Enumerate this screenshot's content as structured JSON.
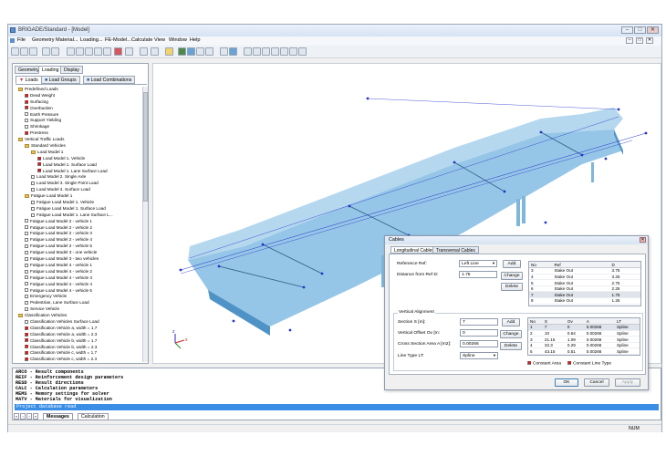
{
  "window": {
    "title": "BRIGADE/Standard - [Model]",
    "controls": [
      "–",
      "□",
      "✕"
    ],
    "child_controls": [
      "–",
      "□",
      "✕"
    ]
  },
  "menu": [
    "File",
    "Geometry",
    "Material...",
    "Loading...",
    "FE-Model...",
    "Calculate",
    "View",
    "Window",
    "Help"
  ],
  "left_panel": {
    "top_tabs": [
      "Geometry",
      "Loading",
      "Display"
    ],
    "sub_tabs": [
      "Loads",
      "Load Groups",
      "Load Combinations"
    ],
    "tree": [
      {
        "level": 0,
        "type": "folder",
        "label": "Predefined Loads"
      },
      {
        "level": 1,
        "type": "check",
        "checked": true,
        "label": "Dead Weight"
      },
      {
        "level": 1,
        "type": "check",
        "checked": true,
        "label": "Surfacing"
      },
      {
        "level": 1,
        "type": "check",
        "checked": true,
        "label": "Overburden"
      },
      {
        "level": 1,
        "type": "check",
        "checked": false,
        "label": "Earth Pressure"
      },
      {
        "level": 1,
        "type": "check",
        "checked": false,
        "label": "Support Yielding"
      },
      {
        "level": 1,
        "type": "check",
        "checked": false,
        "label": "Shrinkage"
      },
      {
        "level": 1,
        "type": "check",
        "checked": true,
        "label": "Prestress"
      },
      {
        "level": 0,
        "type": "folder",
        "label": "Vertical Traffic Loads"
      },
      {
        "level": 1,
        "type": "folder",
        "label": "Standard Vehicles"
      },
      {
        "level": 2,
        "type": "folder",
        "label": "Load Model 1"
      },
      {
        "level": 3,
        "type": "check",
        "checked": true,
        "label": "Load Model 1. Vehicle"
      },
      {
        "level": 3,
        "type": "check",
        "checked": true,
        "label": "Load Model 1. Surface Load"
      },
      {
        "level": 3,
        "type": "check",
        "checked": true,
        "label": "Load Model 1. Lane Surface Load"
      },
      {
        "level": 2,
        "type": "check",
        "checked": false,
        "label": "Load Model 2. Single Axle"
      },
      {
        "level": 2,
        "type": "check",
        "checked": false,
        "label": "Load Model 3. Single Point Load"
      },
      {
        "level": 2,
        "type": "check",
        "checked": false,
        "label": "Load Model 4. Surface Load"
      },
      {
        "level": 1,
        "type": "folder",
        "label": "Fatigue Load Model 1"
      },
      {
        "level": 2,
        "type": "check",
        "checked": false,
        "label": "Fatigue Load Model 1. Vehicle"
      },
      {
        "level": 2,
        "type": "check",
        "checked": false,
        "label": "Fatigue Load Model 1. Surface Load"
      },
      {
        "level": 2,
        "type": "check",
        "checked": false,
        "label": "Fatigue Load Model 1. Lane Surface L..."
      },
      {
        "level": 1,
        "type": "check",
        "checked": false,
        "label": "Fatigue Load Model 2 - vehicle 1"
      },
      {
        "level": 1,
        "type": "check",
        "checked": false,
        "label": "Fatigue Load Model 2 - vehicle 2"
      },
      {
        "level": 1,
        "type": "check",
        "checked": false,
        "label": "Fatigue Load Model 2 - vehicle 3"
      },
      {
        "level": 1,
        "type": "check",
        "checked": false,
        "label": "Fatigue Load Model 2 - vehicle 4"
      },
      {
        "level": 1,
        "type": "check",
        "checked": false,
        "label": "Fatigue Load Model 2 - vehicle 5"
      },
      {
        "level": 1,
        "type": "check",
        "checked": false,
        "label": "Fatigue Load Model 3 - one vehicle"
      },
      {
        "level": 1,
        "type": "check",
        "checked": false,
        "label": "Fatigue Load Model 3 - two vehicles"
      },
      {
        "level": 1,
        "type": "check",
        "checked": false,
        "label": "Fatigue Load Model 4 - vehicle 1"
      },
      {
        "level": 1,
        "type": "check",
        "checked": false,
        "label": "Fatigue Load Model 4 - vehicle 2"
      },
      {
        "level": 1,
        "type": "check",
        "checked": false,
        "label": "Fatigue Load Model 4 - vehicle 3"
      },
      {
        "level": 1,
        "type": "check",
        "checked": false,
        "label": "Fatigue Load Model 4 - vehicle 4"
      },
      {
        "level": 1,
        "type": "check",
        "checked": false,
        "label": "Fatigue Load Model 4 - vehicle 5"
      },
      {
        "level": 1,
        "type": "check",
        "checked": false,
        "label": "Emergency Vehicle"
      },
      {
        "level": 1,
        "type": "check",
        "checked": false,
        "label": "Pedestrian, Lane Surface Load"
      },
      {
        "level": 1,
        "type": "check",
        "checked": false,
        "label": "Service Vehicle"
      },
      {
        "level": 0,
        "type": "folder",
        "label": "Classification Vehicles"
      },
      {
        "level": 1,
        "type": "check",
        "checked": false,
        "label": "Classification Vehicles Surface Load"
      },
      {
        "level": 1,
        "type": "check",
        "checked": true,
        "label": "Classification Vehicle a, width = 1.7"
      },
      {
        "level": 1,
        "type": "check",
        "checked": true,
        "label": "Classification Vehicle a, width = 2.3"
      },
      {
        "level": 1,
        "type": "check",
        "checked": true,
        "label": "Classification Vehicle b, width = 1.7"
      },
      {
        "level": 1,
        "type": "check",
        "checked": true,
        "label": "Classification Vehicle b, width = 2.3"
      },
      {
        "level": 1,
        "type": "check",
        "checked": true,
        "label": "Classification Vehicle c, width = 1.7"
      },
      {
        "level": 1,
        "type": "check",
        "checked": true,
        "label": "Classification Vehicle c, width = 2.3"
      }
    ]
  },
  "messages": {
    "lines": [
      "ARCO    - Result components",
      "REIF    - Reinforcement design parameters",
      "RESD    - Result directions",
      "CALC    - Calculation parameters",
      "MEMS    - Memory settings for solver",
      "MATV    - Materials for visualization"
    ],
    "highlighted": "Project database read",
    "tabs": [
      "Messages",
      "Calculation"
    ]
  },
  "status": {
    "num": "NUM"
  },
  "dialog": {
    "title": "Cables",
    "tabs": [
      "Longitudinal Cables",
      "Transversal Cables"
    ],
    "ref_label": "Reference Ref:",
    "ref_value": "Left Line",
    "add1": "Add",
    "dist_label": "Distance from Ref D:",
    "dist_value": "1.75",
    "change1": "Change",
    "delete1": "Delete",
    "table1": {
      "headers": [
        "No",
        "Ref",
        "D"
      ],
      "rows": [
        [
          "3",
          "Stake Out",
          "3.75"
        ],
        [
          "4",
          "Stake Out",
          "3.25"
        ],
        [
          "5",
          "Stake Out",
          "2.75"
        ],
        [
          "6",
          "Stake Out",
          "2.25"
        ],
        [
          "7",
          "Stake Out",
          "1.75"
        ],
        [
          "8",
          "Stake Out",
          "1.25"
        ]
      ]
    },
    "va_title": "Vertical Alignment",
    "section_label": "Section S [m]:",
    "section_value": "7",
    "add2": "Add",
    "voffset_label": "Vertical Offset Ov [m:",
    "voffset_value": "0",
    "change2": "Change",
    "area_label": "Cross Section Area  A [m2]:",
    "area_value": "0.00266",
    "delete2": "Delete",
    "linetype_label": "Line Type LT:",
    "linetype_value": "Spline",
    "table2": {
      "headers": [
        "No",
        "S",
        "Ov",
        "A",
        "LT"
      ],
      "rows": [
        [
          "1",
          "7",
          "0",
          "0.00266",
          "Spline"
        ],
        [
          "2",
          "10",
          "0.64",
          "0.00266",
          "Spline"
        ],
        [
          "3",
          "21.15",
          "1.09",
          "0.00266",
          "Spline"
        ],
        [
          "4",
          "32.3",
          "0.29",
          "0.00266",
          "Spline"
        ],
        [
          "5",
          "43.15",
          "0.51",
          "0.00266",
          "Spline"
        ]
      ]
    },
    "const_area": "Constant Area",
    "const_line": "Constant Line Type",
    "ok": "OK",
    "cancel": "Cancel",
    "apply": "Apply"
  },
  "colors": {
    "deck": "#78b6e0",
    "node": "#2233cc",
    "highlight": "#3a8ee6"
  }
}
